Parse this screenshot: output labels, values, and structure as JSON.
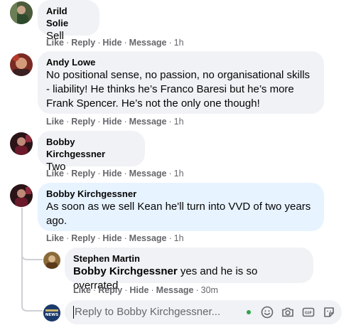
{
  "comments": [
    {
      "author": "Arild Solie",
      "text": "Sell",
      "actions": {
        "like": "Like",
        "reply": "Reply",
        "hide": "Hide",
        "message": "Message",
        "time": "1h"
      }
    },
    {
      "author": "Andy Lowe",
      "text": "No positional sense, no passion, no organisational skills - liability! He thinks he’s Franco Baresi but he’s more Frank Spencer. He’s not the only one though!",
      "actions": {
        "like": "Like",
        "reply": "Reply",
        "hide": "Hide",
        "message": "Message",
        "time": "1h"
      }
    },
    {
      "author": "Bobby Kirchgessner",
      "text": "Two",
      "actions": {
        "like": "Like",
        "reply": "Reply",
        "hide": "Hide",
        "message": "Message",
        "time": "1h"
      }
    },
    {
      "author": "Bobby Kirchgessner",
      "text": "As soon as we sell Kean he'll turn into VVD of two years ago.",
      "actions": {
        "like": "Like",
        "reply": "Reply",
        "hide": "Hide",
        "message": "Message",
        "time": "1h"
      }
    }
  ],
  "reply": {
    "author": "Stephen Martin",
    "mention": "Bobby Kirchgessner",
    "text": " yes and he is so overrated",
    "actions": {
      "like": "Like",
      "reply": "Reply",
      "hide": "Hide",
      "message": "Message",
      "time": "30m"
    }
  },
  "reply_box": {
    "placeholder": "Reply to Bobby Kirchgessner...",
    "avatar_logo": "NEWS",
    "icons": [
      "online-status-dot",
      "emoji-icon",
      "camera-icon",
      "gif-icon",
      "sticker-icon"
    ]
  },
  "colors": {
    "bubble": "#f0f2f5",
    "bubble_highlight": "#e7f3ff",
    "meta_text": "#65676b",
    "online": "#31a24c"
  }
}
